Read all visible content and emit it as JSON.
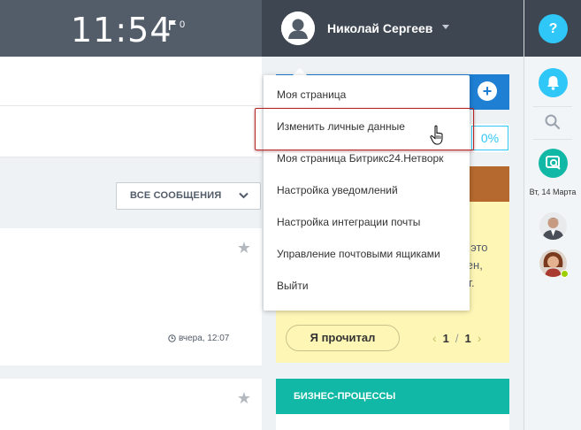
{
  "header": {
    "clock": "11:54",
    "flag_count": "0",
    "user_name": "Николай Сергеев"
  },
  "menu": {
    "items": [
      {
        "label": "Моя страница"
      },
      {
        "label": "Изменить личные данные"
      },
      {
        "label": "Моя страница Битрикс24.Нетворк"
      },
      {
        "label": "Настройка уведомлений"
      },
      {
        "label": "Настройка интеграции почты"
      },
      {
        "label": "Управление почтовыми ящиками"
      },
      {
        "label": "Выйти"
      }
    ],
    "highlighted_index": 1
  },
  "feed": {
    "filter_label": "ВСЕ СООБЩЕНИЯ",
    "post_time": "вчера, 12:07"
  },
  "right_column": {
    "progress_pct": "0%",
    "notice_lines": [
      "у это",
      "тен,",
      "ут."
    ],
    "read_button": "Я прочитал",
    "pager_current": "1",
    "pager_sep": "/",
    "pager_total": "1",
    "business_processes": "БИЗНЕС-ПРОЦЕССЫ"
  },
  "rail": {
    "help_label": "?",
    "date_label": "Вт, 14 Марта"
  },
  "colors": {
    "header_bg": "#535c69",
    "header_dark": "#3e4651",
    "accent_blue": "#2fc7f7",
    "teal": "#12b8a6",
    "notice_bg": "#fef6b5",
    "highlight_border": "#b32428"
  }
}
